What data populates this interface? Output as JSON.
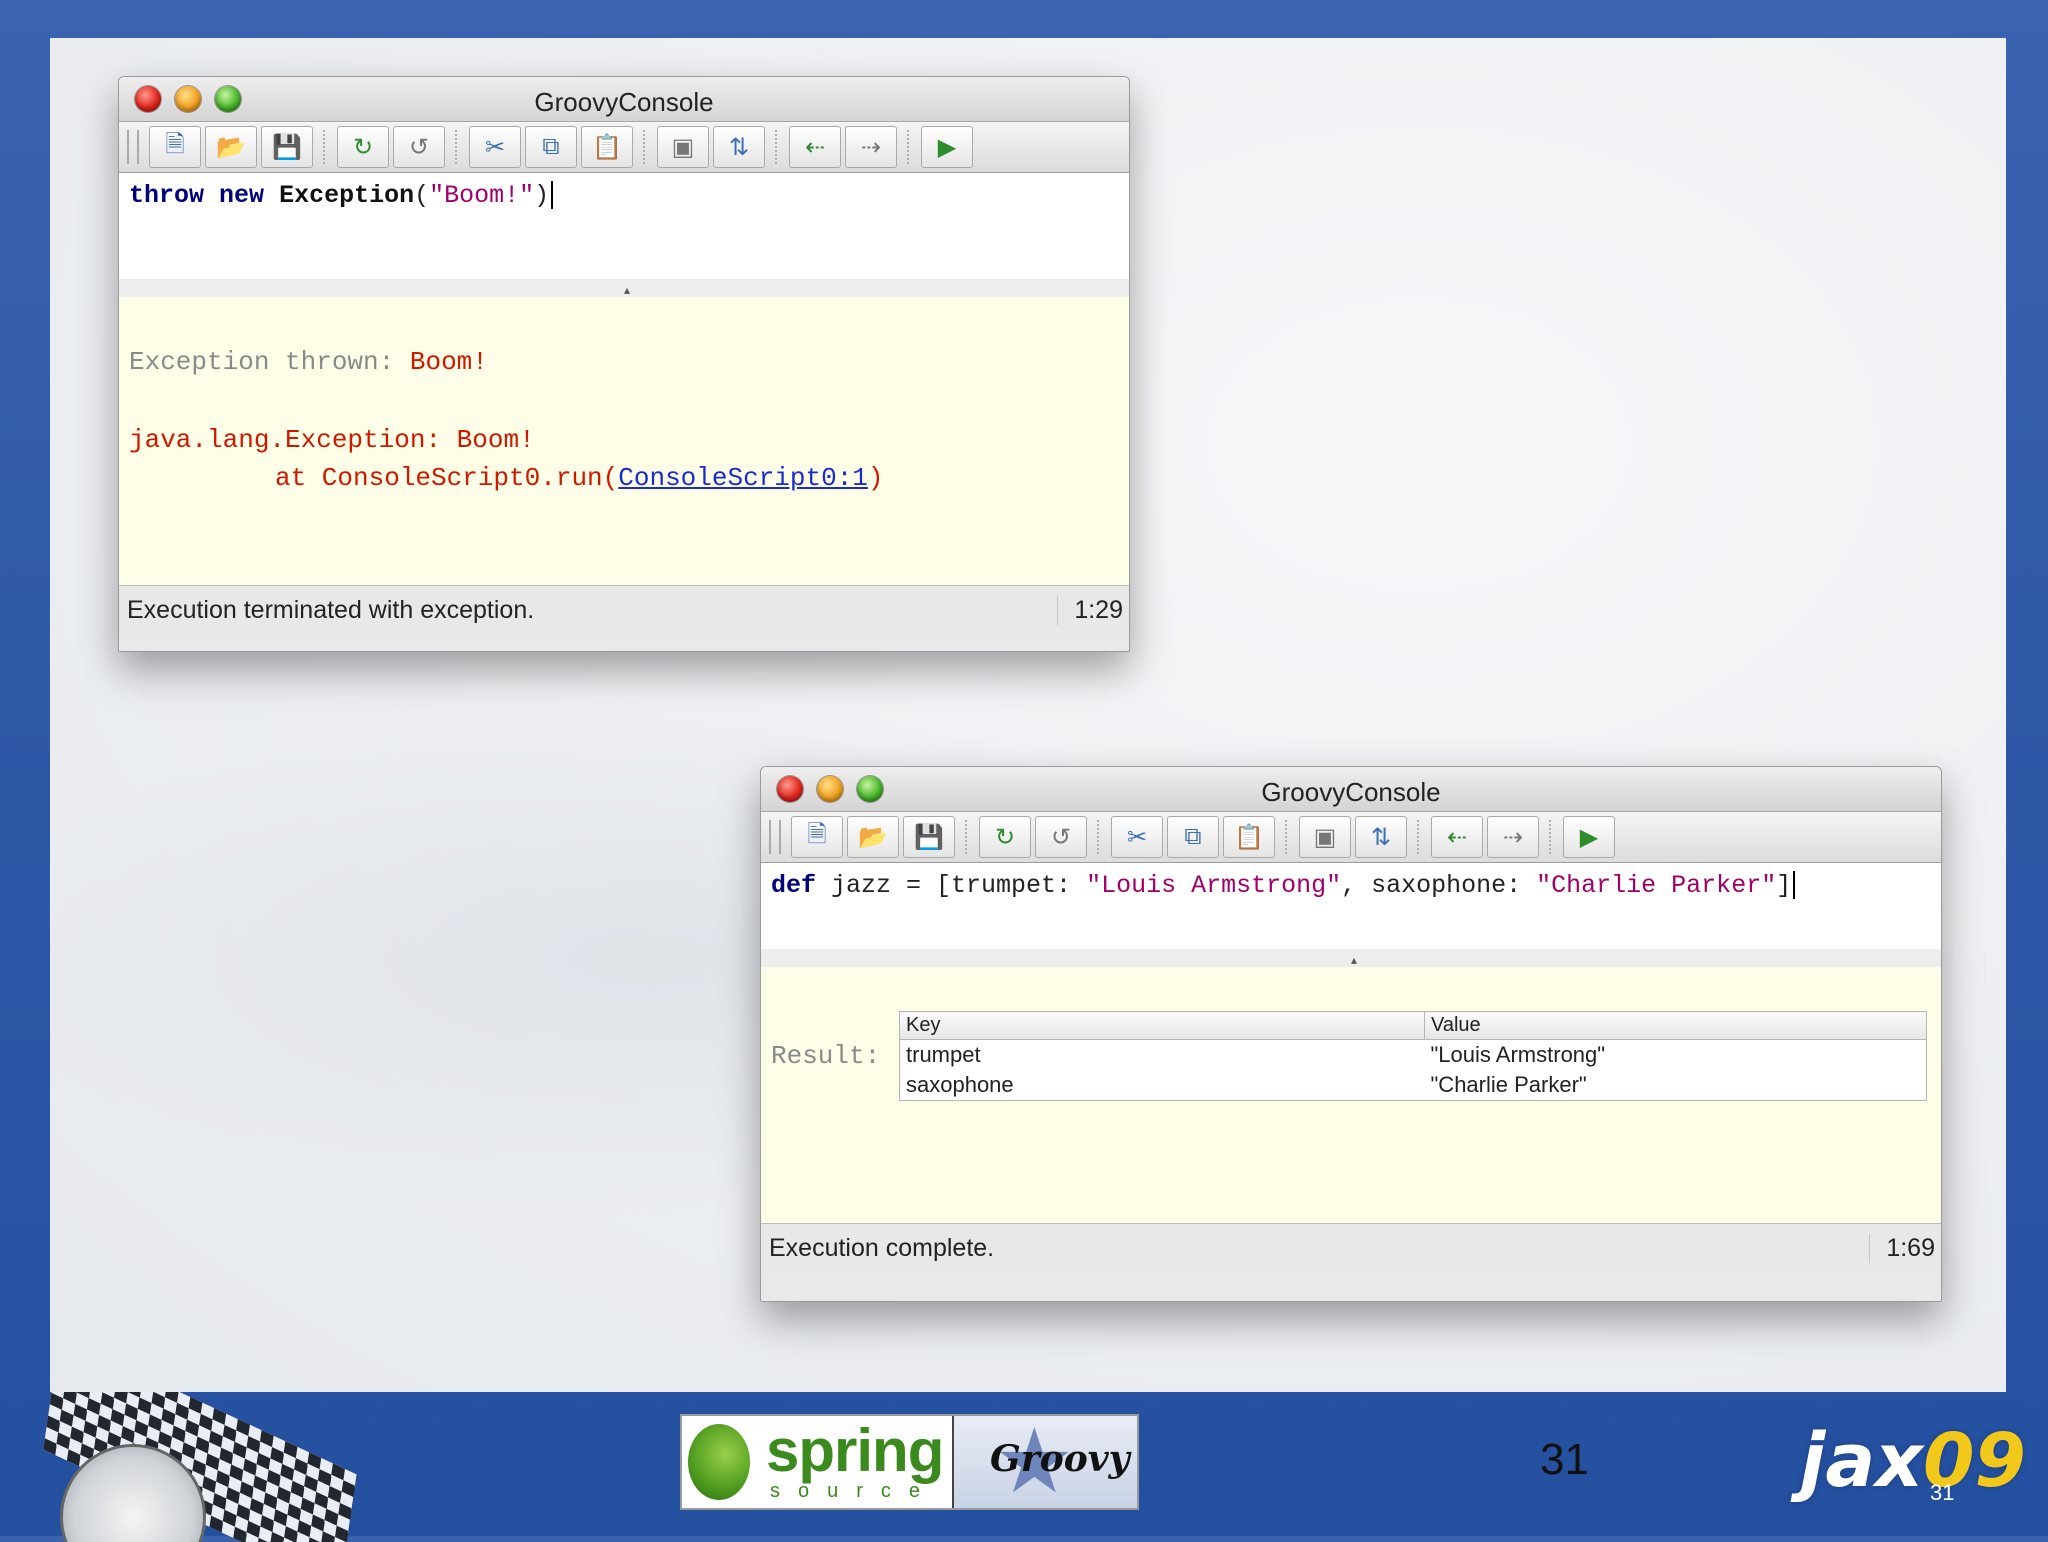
{
  "window1": {
    "title": "GroovyConsole",
    "editor": {
      "kw1": "throw",
      "kw2": "new",
      "cls": "Exception",
      "open": "(",
      "str": "\"Boom!\"",
      "close": ")"
    },
    "output": {
      "exception_label": "Exception thrown: ",
      "exception_value": "Boom!",
      "stack_line1": "java.lang.Exception: Boom!",
      "stack_line2_prefix": "at ConsoleScript0.run(",
      "stack_line2_link": "ConsoleScript0:1",
      "stack_line2_suffix": ")"
    },
    "status": "Execution terminated with exception.",
    "position": "1:29"
  },
  "window2": {
    "title": "GroovyConsole",
    "editor": {
      "kw": "def",
      "code1": " jazz = [trumpet: ",
      "str1": "\"Louis Armstrong\"",
      "code2": ", saxophone: ",
      "str2": "\"Charlie Parker\"",
      "code3": "]"
    },
    "result_label": "Result:",
    "table": {
      "headers": [
        "Key",
        "Value"
      ],
      "rows": [
        {
          "key": "trumpet",
          "value": "\"Louis Armstrong\""
        },
        {
          "key": "saxophone",
          "value": "\"Charlie Parker\""
        }
      ]
    },
    "status": "Execution complete.",
    "position": "1:69"
  },
  "toolbar_icons": [
    "new-file-icon",
    "open-file-icon",
    "save-icon",
    "undo-icon",
    "redo-icon",
    "cut-icon",
    "copy-icon",
    "paste-icon",
    "find-icon",
    "replace-icon",
    "history-back-icon",
    "history-forward-icon",
    "run-script-icon"
  ],
  "footer": {
    "slide_number": "31",
    "spring_word": "spring",
    "source_word": "source",
    "groovy_word": "Groovy",
    "jax_word": "jax",
    "jax_year": "09",
    "jax_page": "31"
  }
}
